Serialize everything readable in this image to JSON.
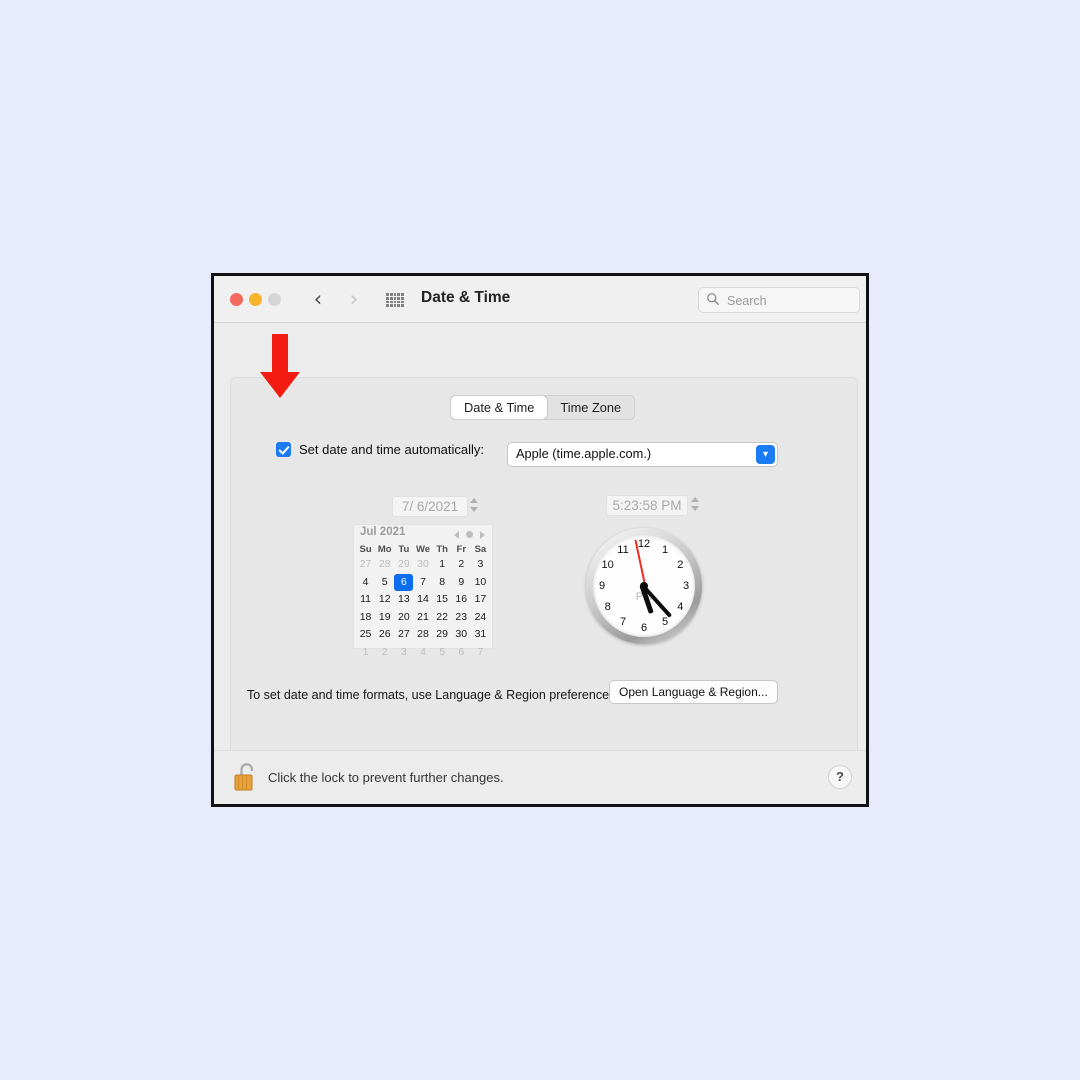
{
  "window": {
    "title": "Date & Time",
    "traffic_lights": [
      "close",
      "minimize",
      "zoom"
    ],
    "nav": {
      "back": "‹",
      "forward": "›"
    },
    "grid_icon": "apps-grid-icon"
  },
  "search": {
    "placeholder": "Search",
    "value": "",
    "icon": "search-icon"
  },
  "tabs": [
    {
      "label": "Date & Time",
      "active": true
    },
    {
      "label": "Time Zone",
      "active": false
    }
  ],
  "auto": {
    "label": "Set date and time automatically:",
    "checked": true,
    "server": "Apple (time.apple.com.)",
    "chevron": "▾"
  },
  "date": {
    "value": "7/  6/2021",
    "stepper": "date-stepper"
  },
  "time": {
    "value": "5:23:58 PM",
    "stepper": "time-stepper"
  },
  "calendar": {
    "month_label": "Jul 2021",
    "prev_icon": "chevron-left-icon",
    "today_icon": "today-dot-icon",
    "next_icon": "chevron-right-icon",
    "day_headers": [
      "Su",
      "Mo",
      "Tu",
      "We",
      "Th",
      "Fr",
      "Sa"
    ],
    "weeks": [
      [
        {
          "d": "27",
          "muted": true
        },
        {
          "d": "28",
          "muted": true
        },
        {
          "d": "29",
          "muted": true
        },
        {
          "d": "30",
          "muted": true
        },
        {
          "d": "1"
        },
        {
          "d": "2"
        },
        {
          "d": "3"
        }
      ],
      [
        {
          "d": "4"
        },
        {
          "d": "5"
        },
        {
          "d": "6",
          "selected": true
        },
        {
          "d": "7"
        },
        {
          "d": "8"
        },
        {
          "d": "9"
        },
        {
          "d": "10"
        }
      ],
      [
        {
          "d": "11"
        },
        {
          "d": "12"
        },
        {
          "d": "13"
        },
        {
          "d": "14"
        },
        {
          "d": "15"
        },
        {
          "d": "16"
        },
        {
          "d": "17"
        }
      ],
      [
        {
          "d": "18"
        },
        {
          "d": "19"
        },
        {
          "d": "20"
        },
        {
          "d": "21"
        },
        {
          "d": "22"
        },
        {
          "d": "23"
        },
        {
          "d": "24"
        }
      ],
      [
        {
          "d": "25"
        },
        {
          "d": "26"
        },
        {
          "d": "27"
        },
        {
          "d": "28"
        },
        {
          "d": "29"
        },
        {
          "d": "30"
        },
        {
          "d": "31"
        }
      ],
      [
        {
          "d": "1",
          "muted": true
        },
        {
          "d": "2",
          "muted": true
        },
        {
          "d": "3",
          "muted": true
        },
        {
          "d": "4",
          "muted": true
        },
        {
          "d": "5",
          "muted": true
        },
        {
          "d": "6",
          "muted": true
        },
        {
          "d": "7",
          "muted": true
        }
      ]
    ]
  },
  "clock": {
    "hour_numbers": [
      "12",
      "1",
      "2",
      "3",
      "4",
      "5",
      "6",
      "7",
      "8",
      "9",
      "10",
      "11"
    ],
    "meridiem": "PM",
    "hour_angle_deg": 161,
    "minute_angle_deg": 138,
    "second_angle_deg": 348
  },
  "footer": {
    "note": "To set date and time formats, use Language & Region preferences.",
    "open_button": "Open Language & Region..."
  },
  "lockbar": {
    "icon": "unlocked-padlock-icon",
    "text": "Click the lock to prevent further changes.",
    "help": "?"
  },
  "annotation": {
    "type": "arrow-down",
    "color": "#f41c12",
    "points_at": "set-date-time-automatically-checkbox"
  },
  "colors": {
    "desktop_background": "#e8ebfc",
    "window_chrome": "#ececec",
    "accent_blue": "#1a7bf2",
    "selection_blue": "#0b6ef0",
    "annotation_red": "#f41c12"
  }
}
